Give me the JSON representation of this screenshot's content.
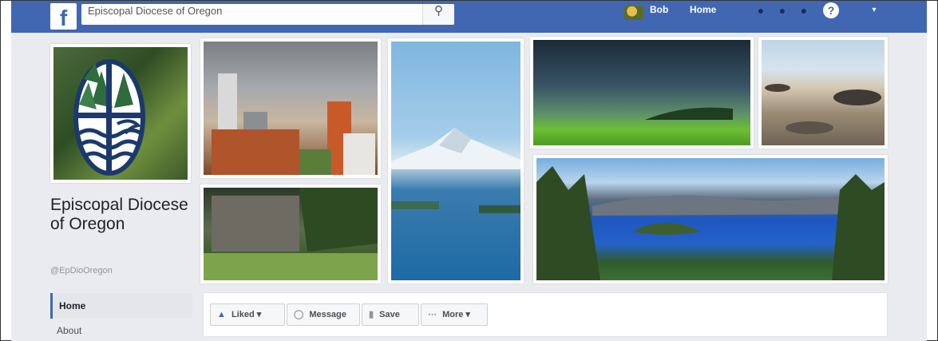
{
  "topbar": {
    "search_value": "Episcopal Diocese of Oregon",
    "search_icon": "search-icon",
    "user_name": "Bob",
    "home_label": "Home",
    "help_icon": "help-icon",
    "accent_color": "#4267b2"
  },
  "profile": {
    "page_name": "Episcopal Diocese of Oregon",
    "handle": "@EpDioOregon"
  },
  "nav": {
    "items": [
      {
        "label": "Home",
        "active": true
      },
      {
        "label": "About",
        "active": false
      }
    ]
  },
  "actions": {
    "liked_label": "Liked ▾",
    "message_label": "Message",
    "save_label": "Save",
    "more_label": "More ▾"
  }
}
